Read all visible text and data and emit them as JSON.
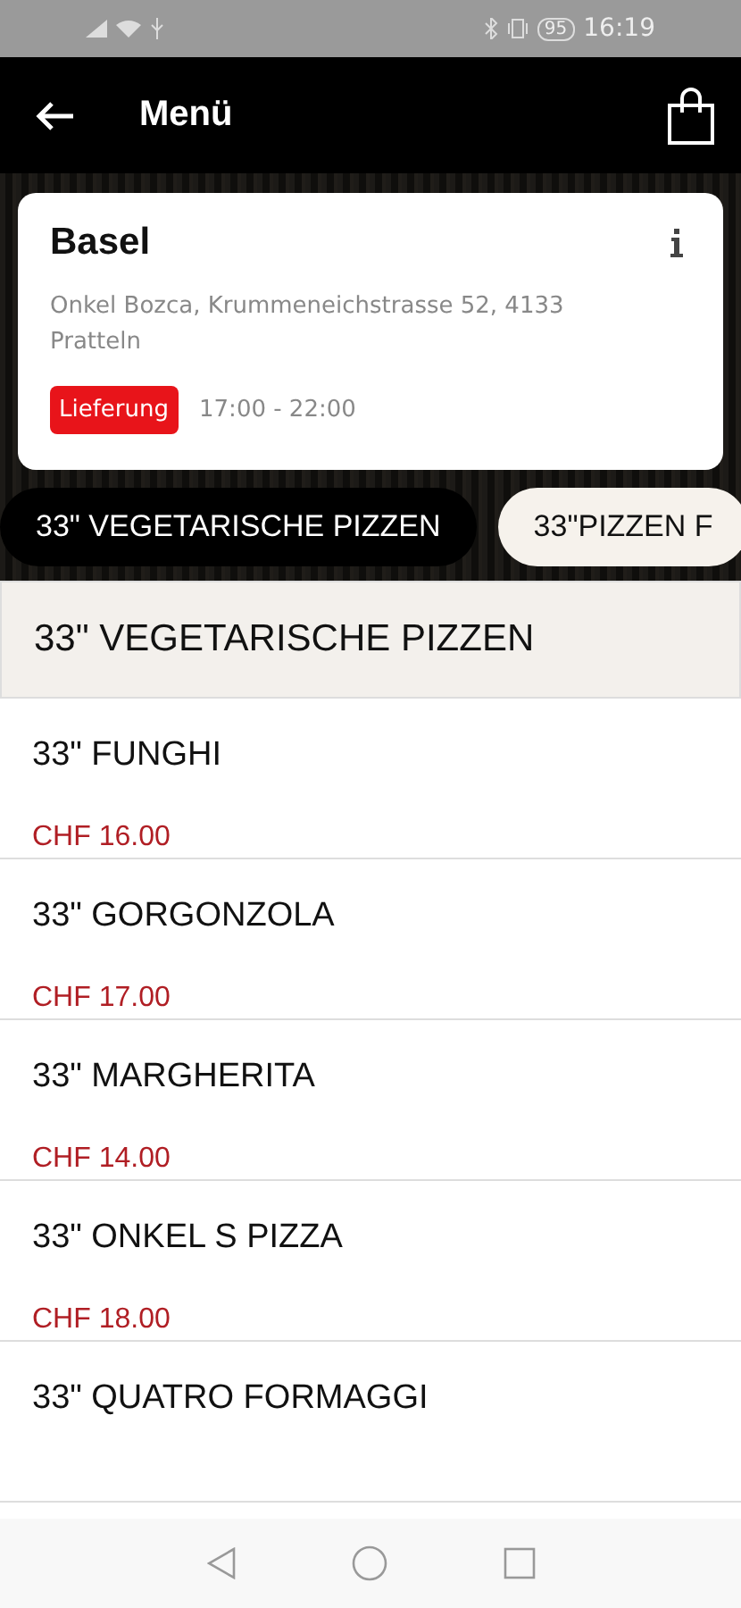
{
  "status_bar": {
    "battery": "95",
    "time": "16:19"
  },
  "header": {
    "title": "Menü"
  },
  "store": {
    "name": "Basel",
    "address": "Onkel Bozca, Krummeneichstrasse 52, 4133 Pratteln",
    "badge": "Lieferung",
    "hours": "17:00 - 22:00"
  },
  "categories": [
    {
      "label": "33\" VEGETARISCHE PIZZEN",
      "selected": true
    },
    {
      "label": "33\"PIZZEN F",
      "selected": false
    }
  ],
  "section": {
    "title": "33\" VEGETARISCHE PIZZEN"
  },
  "items": [
    {
      "name": "33\" FUNGHI",
      "price": "CHF 16.00"
    },
    {
      "name": "33\" GORGONZOLA",
      "price": "CHF 17.00"
    },
    {
      "name": "33\" MARGHERITA",
      "price": "CHF 14.00"
    },
    {
      "name": "33\" ONKEL S PIZZA",
      "price": "CHF 18.00"
    },
    {
      "name": "33\" QUATRO FORMAGGI"
    }
  ]
}
